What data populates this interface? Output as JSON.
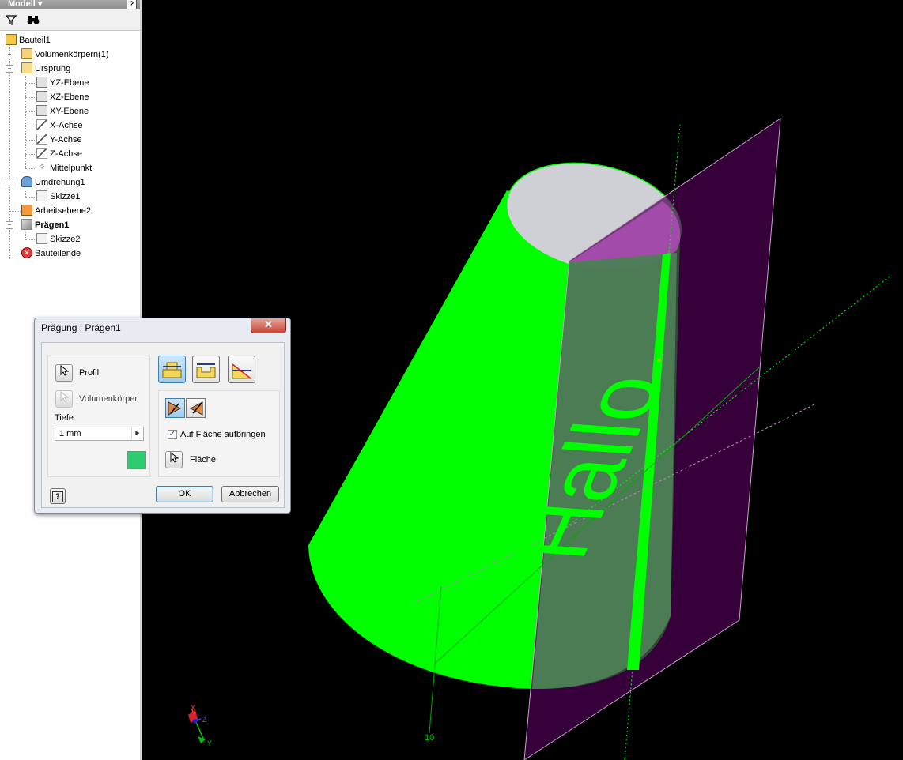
{
  "browser": {
    "title": "Modell",
    "nodes": [
      {
        "label": "Bauteil1"
      },
      {
        "label": "Volumenkörpern(1)"
      },
      {
        "label": "Ursprung"
      },
      {
        "label": "YZ-Ebene"
      },
      {
        "label": "XZ-Ebene"
      },
      {
        "label": "XY-Ebene"
      },
      {
        "label": "X-Achse"
      },
      {
        "label": "Y-Achse"
      },
      {
        "label": "Z-Achse"
      },
      {
        "label": "Mittelpunkt"
      },
      {
        "label": "Umdrehung1"
      },
      {
        "label": "Skizze1"
      },
      {
        "label": "Arbeitsebene2"
      },
      {
        "label": "Prägen1"
      },
      {
        "label": "Skizze2"
      },
      {
        "label": "Bauteilende"
      }
    ]
  },
  "dialog": {
    "title": "Prägung : Prägen1",
    "close": "✕",
    "profile_label": "Profil",
    "solid_label": "Volumenkörper",
    "depth_label": "Tiefe",
    "depth_value": "1 mm",
    "wrap_label": "Auf Fläche aufbringen",
    "wrap_checked": true,
    "face_label": "Fläche",
    "ok": "OK",
    "cancel": "Abbrechen",
    "color_swatch": "#2ecc71"
  },
  "viewport": {
    "emboss_text": "Hallo",
    "dimension_label": "10",
    "axis_x": "X",
    "axis_y": "Y",
    "axis_z": "Z",
    "colors": {
      "body": "#00ff00",
      "plane": "#4b0050",
      "top_face": "#cfcfd6",
      "background": "#000000"
    }
  }
}
